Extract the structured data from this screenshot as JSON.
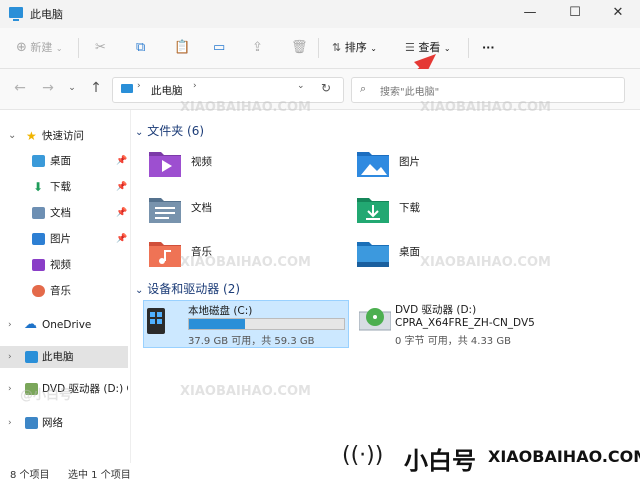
{
  "window": {
    "title": "此电脑",
    "minimize": "—",
    "maximize": "☐",
    "close": "✕"
  },
  "commandbar": {
    "new_label": "新建",
    "sort_label": "排序",
    "view_label": "查看",
    "more_label": "···"
  },
  "address": {
    "path_segment": "此电脑",
    "search_placeholder": "搜索\"此电脑\""
  },
  "sidebar": {
    "items": [
      {
        "label": "快速访问"
      },
      {
        "label": "桌面"
      },
      {
        "label": "下载"
      },
      {
        "label": "文档"
      },
      {
        "label": "图片"
      },
      {
        "label": "视频"
      },
      {
        "label": "音乐"
      },
      {
        "label": "OneDrive"
      },
      {
        "label": "此电脑"
      },
      {
        "label": "DVD 驱动器 (D:) CI"
      },
      {
        "label": "网络"
      }
    ]
  },
  "main": {
    "folders_header": "文件夹 (6)",
    "folders": [
      {
        "name": "视频"
      },
      {
        "name": "图片"
      },
      {
        "name": "文档"
      },
      {
        "name": "下载"
      },
      {
        "name": "音乐"
      },
      {
        "name": "桌面"
      }
    ],
    "devices_header": "设备和驱动器 (2)",
    "drives": [
      {
        "name": "本地磁盘 (C:)",
        "space": "37.9 GB 可用，共 59.3 GB",
        "used_fraction": 0.36
      },
      {
        "name": "DVD 驱动器 (D:)",
        "label": "CPRA_X64FRE_ZH-CN_DV5",
        "space": "0 字节 可用，共 4.33 GB"
      }
    ]
  },
  "status": {
    "item_count": "8 个项目",
    "selected": "选中 1 个项目"
  },
  "watermark": {
    "brand_cn": "小白号",
    "brand_en": "XIAOBAIHAO.COM",
    "tile_en": "XIAOBAIHAO.COM",
    "tile_cn": "@小白号"
  },
  "colors": {
    "accent": "#0078d4",
    "selection": "#cce8ff",
    "arrow": "#e53935"
  }
}
